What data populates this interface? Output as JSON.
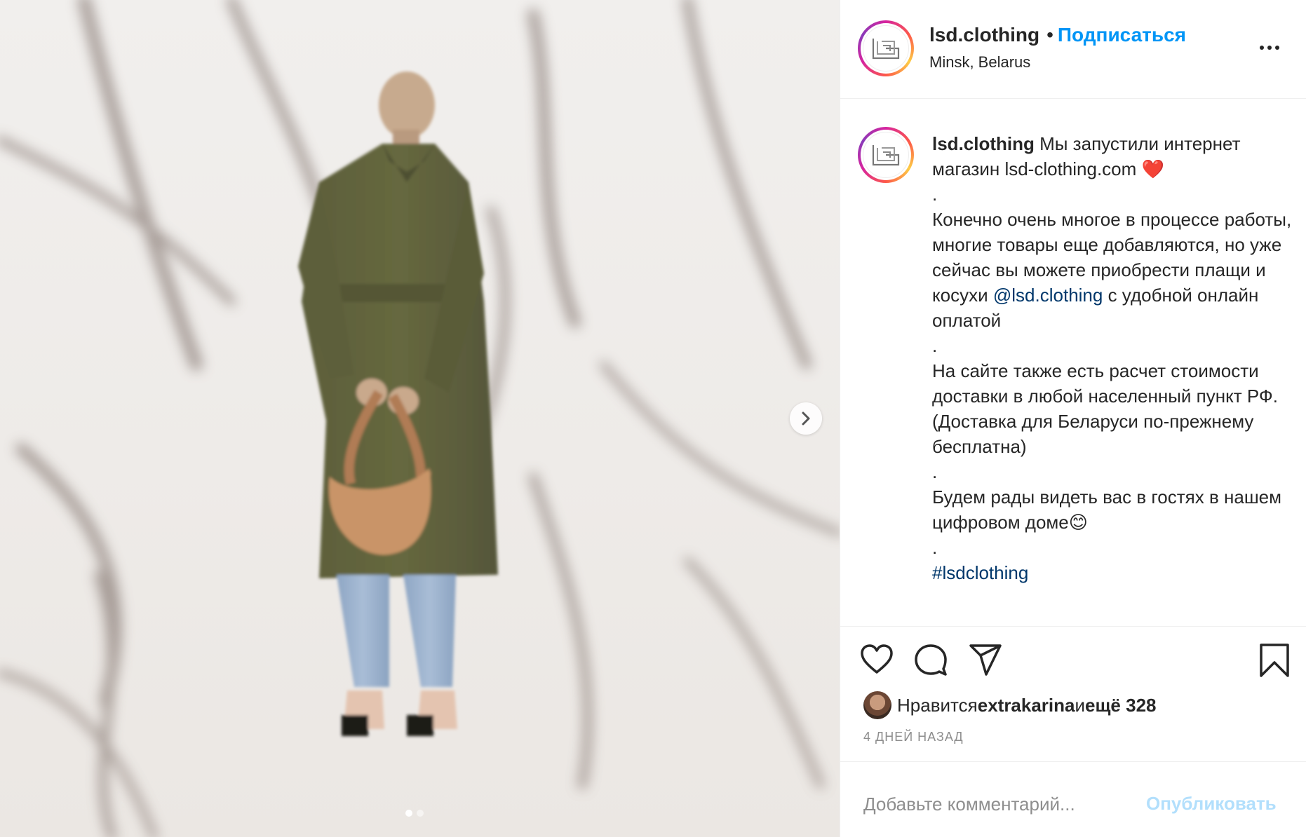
{
  "post": {
    "carousel": {
      "slide_count": 2,
      "active_index": 0
    }
  },
  "header": {
    "username": "lsd.clothing",
    "separator": "•",
    "follow_label": "Подписаться",
    "location": "Minsk, Belarus",
    "avatar_monogram": "LSD"
  },
  "caption": {
    "username": "lsd.clothing",
    "text_1": " Мы запустили интернет магазин lsd-clothing.com ❤️\n.\nКонечно очень многое в процессе работы, многие товары еще добавляются, но уже сейчас вы можете приобрести плащи и косухи ",
    "mention": "@lsd.clothing",
    "text_2": " с удобной онлайн оплатой\n.\nНа сайте также есть расчет стоимости доставки в любой населенный пункт РФ. (Доставка для Беларуси по-прежнему бесплатна)\n.\nБудем рады видеть вас в гостях в нашем цифровом доме😊\n.\n",
    "hashtag": "#lsdclothing"
  },
  "likes": {
    "prefix": "Нравится ",
    "user": "extrakarina",
    "middle": " и ",
    "others": "ещё 328"
  },
  "timestamp": "4 ДНЕЙ НАЗАД",
  "comment": {
    "placeholder": "Добавьте комментарий...",
    "publish_label": "Опубликовать"
  },
  "icons": {
    "like": "heart-icon",
    "comment": "comment-bubble-icon",
    "share": "paper-plane-icon",
    "save": "bookmark-icon",
    "more": "more-options-icon",
    "next": "chevron-right-icon"
  },
  "colors": {
    "follow_blue": "#0095f6",
    "link_blue": "#00376b",
    "publish_disabled": "#b2dffc",
    "muted_gray": "#8e8e8e",
    "text": "#262626"
  }
}
